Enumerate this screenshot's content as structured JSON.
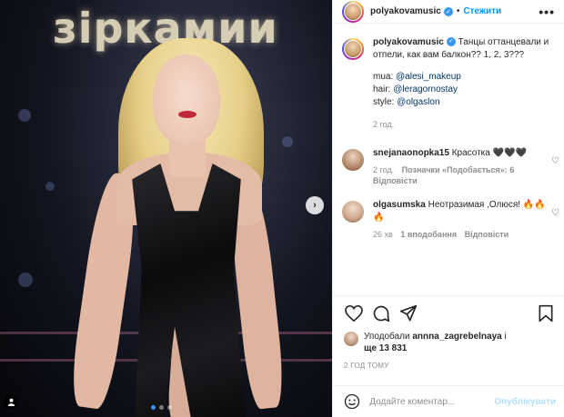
{
  "photo": {
    "background_sign": "зіркамии",
    "carousel_dots": 3,
    "active_dot": 0
  },
  "header": {
    "username": "polyakovamusic",
    "separator": "•",
    "follow_label": "Стежити",
    "more_label": "•••"
  },
  "caption": {
    "username": "polyakovamusic",
    "text": "Танцы оттанцевали и отпели, как вам балкон?? 1, 2, 3???",
    "mua_label": "mua: ",
    "mua_link": "@alesi_makeup",
    "hair_label": "hair: ",
    "hair_link": "@leragornostay",
    "style_label": "style: ",
    "style_link": "@olgaslon",
    "time": "2 год."
  },
  "comments": [
    {
      "username": "snejanaonopka15",
      "text": "Красотка 🖤🖤🖤",
      "time": "2 год.",
      "likes": "Позначки «Подобається»: 6",
      "reply": "Відповісти"
    },
    {
      "username": "olgasumska",
      "text": "Неотразимая ,Олюся! 🔥🔥🔥",
      "time": "26 хв",
      "likes": "1 вподобання",
      "reply": "Відповісти"
    }
  ],
  "likes": {
    "prefix": "Уподобали ",
    "user": "annna_zagrebelnaya",
    "suffix": " і",
    "count": "ще 13 831"
  },
  "post_time": "2 ГОД ТОМУ",
  "add_comment": {
    "placeholder": "Додайте коментар...",
    "publish_label": "Опублікувати"
  },
  "colors": {
    "accent": "#0095f6",
    "verified": "#3897f0",
    "publish_disabled": "#b2dffc",
    "muted": "#8e8e8e"
  }
}
